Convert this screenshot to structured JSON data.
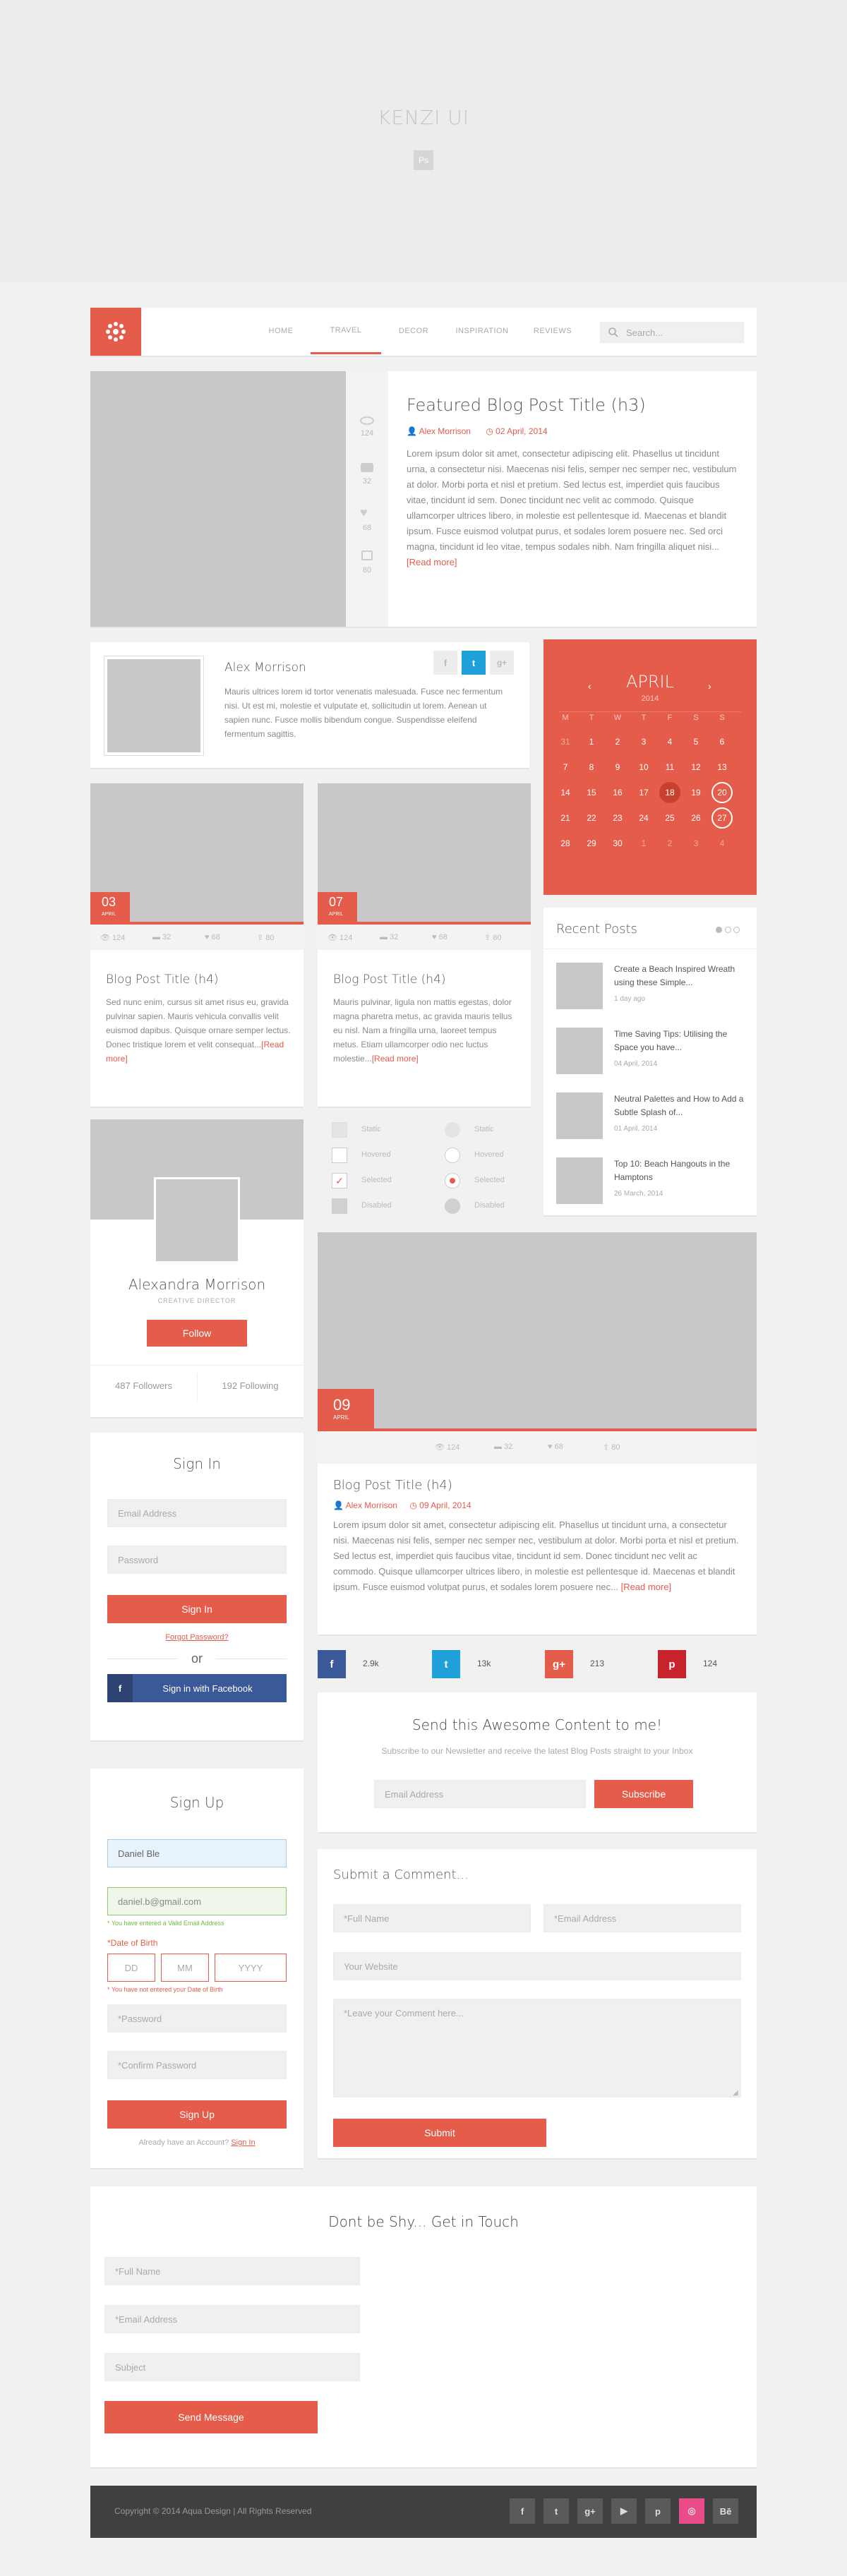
{
  "header": {
    "title": "KENZI UI",
    "ps_badge": "Ps"
  },
  "nav": {
    "items": [
      "HOME",
      "TRAVEL",
      "DECOR",
      "INSPIRATION",
      "REVIEWS"
    ],
    "search_placeholder": "Search..."
  },
  "featured": {
    "title": "Featured Blog Post Title (h3)",
    "author": "Alex Morrison",
    "date": "02 April, 2014",
    "stats": [
      "124",
      "32",
      "68",
      "80"
    ],
    "body": "Lorem ipsum dolor sit amet, consectetur adipiscing elit. Phasellus ut tincidunt urna, a consectetur nisi. Maecenas nisi felis, semper nec semper nec, vestibulum at dolor. Morbi porta et nisl et pretium. Sed lectus est, imperdiet quis faucibus vitae, tincidunt id sem. Donec tincidunt nec velit ac commodo. Quisque ullamcorper ultrices libero, in molestie est pellentesque id. Maecenas et blandit ipsum. Fusce euismod volutpat purus, et sodales lorem posuere nec. Sed orci magna, tincidunt id leo vitae, tempus sodales nibh. Nam fringilla aliquet nisi...",
    "read_more": "[Read more]"
  },
  "author_box": {
    "name": "Alex Morrison",
    "body": "Mauris ultrices lorem id tortor venenatis malesuada. Fusce nec fermentum nisi. Ut est mi, molestie et vulputate et, sollicitudin ut lorem. Aenean ut sapien nunc. Fusce mollis bibendum congue. Suspendisse eleifend fermentum sagittis.",
    "social": [
      "f",
      "t",
      "g+"
    ]
  },
  "calendar": {
    "month": "APRIL",
    "year": "2014",
    "days": [
      "M",
      "T",
      "W",
      "T",
      "F",
      "S",
      "S"
    ],
    "weeks": [
      [
        "31",
        "1",
        "2",
        "3",
        "4",
        "5",
        "6"
      ],
      [
        "7",
        "8",
        "9",
        "10",
        "11",
        "12",
        "13"
      ],
      [
        "14",
        "15",
        "16",
        "17",
        "18",
        "19",
        "20"
      ],
      [
        "21",
        "22",
        "23",
        "24",
        "25",
        "26",
        "27"
      ],
      [
        "28",
        "29",
        "30",
        "1",
        "2",
        "3",
        "4"
      ]
    ],
    "highlight_filled": "18",
    "highlight_outline_a": "20",
    "highlight_outline_b": "27"
  },
  "small_posts": [
    {
      "day": "03",
      "month": "APRIL",
      "stats": [
        "124",
        "32",
        "68",
        "80"
      ],
      "title": "Blog Post Title (h4)",
      "body": "Sed nunc enim, cursus sit amet risus eu, gravida pulvinar sapien. Mauris vehicula convallis velit euismod dapibus. Quisque ornare semper lectus. Donec tristique lorem et velit consequat...",
      "read_more": "[Read more]"
    },
    {
      "day": "07",
      "month": "APRIL",
      "stats": [
        "124",
        "32",
        "68",
        "80"
      ],
      "title": "Blog Post Title (h4)",
      "body": "Mauris pulvinar, ligula non mattis egestas, dolor magna pharetra metus, ac gravida mauris tellus eu nisl. Nam a fringilla urna, laoreet tempus metus. Etiam ullamcorper odio nec luctus molestie...",
      "read_more": "[Read more]"
    }
  ],
  "recent": {
    "title": "Recent Posts",
    "items": [
      {
        "title": "Create a Beach Inspired Wreath using these Simple...",
        "date": "1 day ago"
      },
      {
        "title": "Time Saving Tips: Utilising the Space you have...",
        "date": "04 April, 2014"
      },
      {
        "title": "Neutral Palettes and How to Add a Subtle Splash of...",
        "date": "01 April, 2014"
      },
      {
        "title": "Top 10: Beach Hangouts in the Hamptons",
        "date": "26 March, 2014"
      }
    ]
  },
  "profile": {
    "name": "Alexandra Morrison",
    "role": "CREATIVE DIRECTOR",
    "follow": "Follow",
    "followers": "487 Followers",
    "following": "192 Following"
  },
  "controls": {
    "checkbox_labels": [
      "Static",
      "Hovered",
      "Selected",
      "Disabled"
    ],
    "radio_labels": [
      "Static",
      "Hovered",
      "Selected",
      "Disabled"
    ]
  },
  "big_post": {
    "day": "09",
    "month": "APRIL",
    "stats": [
      "124",
      "32",
      "68",
      "80"
    ],
    "title": "Blog Post Title (h4)",
    "author": "Alex Morrison",
    "date": "09 April, 2014",
    "body": "Lorem ipsum dolor sit amet, consectetur adipiscing elit. Phasellus ut tincidunt urna, a consectetur nisi. Maecenas nisi felis, semper nec semper nec, vestibulum at dolor. Morbi porta et nisl et pretium. Sed lectus est, imperdiet quis faucibus vitae, tincidunt id sem. Donec tincidunt nec velit ac commodo. Quisque ullamcorper ultrices libero, in molestie est pellentesque id. Maecenas et blandit ipsum. Fusce euismod volutpat purus, et sodales lorem posuere nec...",
    "read_more": "[Read more]"
  },
  "signin": {
    "title": "Sign In",
    "email_placeholder": "Email Address",
    "password_placeholder": "Password",
    "button": "Sign In",
    "forgot": "Forgot Password?",
    "or": "or",
    "facebook": "Sign in with Facebook"
  },
  "share": {
    "counts": [
      "2.9k",
      "13k",
      "213",
      "124"
    ],
    "glyphs": [
      "f",
      "t",
      "g+",
      "p"
    ]
  },
  "newsletter": {
    "title": "Send this Awesome Content to me!",
    "text": "Subscribe to our Newsletter and receive the latest Blog Posts straight to your Inbox",
    "email_placeholder": "Email Address",
    "button": "Subscribe"
  },
  "signup": {
    "title": "Sign Up",
    "name_value": "Daniel Ble",
    "email_value": "daniel.b@gmail.com",
    "email_valid": "* You have entered a Valid Email Address",
    "dob_label": "*Date of Birth",
    "dd": "DD",
    "mm": "MM",
    "yyyy": "YYYY",
    "dob_error": "* You have not entered your Date of Birth",
    "password_placeholder": "*Password",
    "confirm_placeholder": "*Confirm Password",
    "button": "Sign Up",
    "already": "Already have an Account?",
    "signin_link": "Sign In"
  },
  "comment": {
    "title": "Submit a Comment...",
    "name_placeholder": "*Full Name",
    "email_placeholder": "*Email Address",
    "website_placeholder": "Your Website",
    "comment_placeholder": "*Leave your Comment here...",
    "button": "Submit"
  },
  "contact": {
    "title": "Dont be Shy... Get in Touch",
    "name_placeholder": "*Full Name",
    "email_placeholder": "*Email Address",
    "subject_placeholder": "Subject",
    "button": "Send Message"
  },
  "footer": {
    "copyright": "Copyright © 2014 Aqua Design | All Rights Reserved",
    "icons": [
      "f",
      "t",
      "g+",
      "▶",
      "p",
      "◎",
      "Bē"
    ]
  },
  "colors": {
    "accent": "#e55c4a",
    "facebook": "#3b5998",
    "twitter": "#1da1d8",
    "pinterest": "#c8232c",
    "footer": "#404040"
  }
}
